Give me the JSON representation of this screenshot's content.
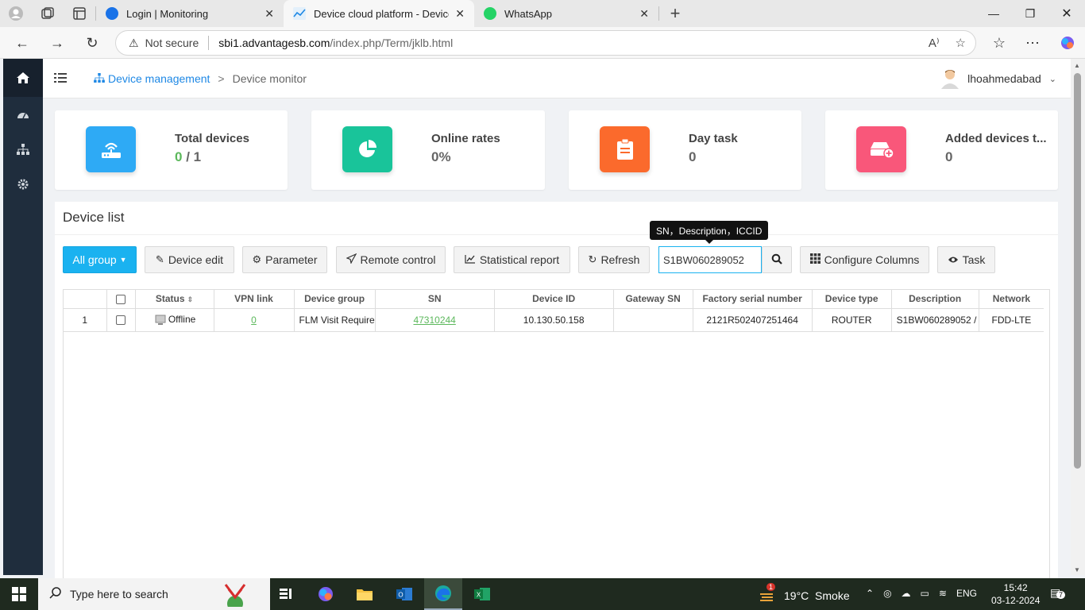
{
  "browser": {
    "tabs": [
      {
        "title": "Login | Monitoring",
        "active": false,
        "favicon_color": "#1a73e8"
      },
      {
        "title": "Device cloud platform - Device m",
        "active": true,
        "favicon_color": "#1e88e5"
      },
      {
        "title": "WhatsApp",
        "active": false,
        "favicon_color": "#25d366"
      }
    ],
    "new_tab_label": "+",
    "address": {
      "security_label": "Not secure",
      "host": "sbi1.advantagesb.com",
      "path": "/index.php/Term/jklb.html"
    }
  },
  "header": {
    "breadcrumb_root": "Device management",
    "breadcrumb_sep": ">",
    "breadcrumb_current": "Device monitor",
    "username": "lhoahmedabad"
  },
  "stats": [
    {
      "label": "Total devices",
      "value_online": "0",
      "value_sep": " / ",
      "value_total": "1",
      "color": "#2eaaf5",
      "icon": "router-icon"
    },
    {
      "label": "Online rates",
      "value": "0%",
      "color": "#19c49a",
      "icon": "pie-chart-icon"
    },
    {
      "label": "Day task",
      "value": "0",
      "color": "#fb6a2c",
      "icon": "clipboard-icon"
    },
    {
      "label": "Added devices t...",
      "value": "0",
      "color": "#f9577a",
      "icon": "add-device-icon"
    }
  ],
  "panel": {
    "title": "Device list",
    "toolbar": {
      "group": "All group",
      "device_edit": "Device edit",
      "parameter": "Parameter",
      "remote_control": "Remote control",
      "statistical_report": "Statistical report",
      "refresh": "Refresh",
      "search_value": "S1BW060289052",
      "search_tooltip": "SN，Description，ICCID",
      "configure_columns": "Configure Columns",
      "task": "Task"
    },
    "table": {
      "columns": [
        "Status",
        "VPN link",
        "Device group",
        "SN",
        "Device ID",
        "Gateway SN",
        "Factory serial number",
        "Device type",
        "Description",
        "Network"
      ],
      "rows": [
        {
          "index": "1",
          "status": "Offline",
          "vpn_link": "0",
          "device_group": "FLM Visit Require",
          "sn": "47310244",
          "device_id": "10.130.50.158",
          "gateway_sn": "",
          "factory_serial": "2121R502407251464",
          "device_type": "ROUTER",
          "description": "S1BW060289052 /",
          "network": "FDD-LTE"
        }
      ]
    }
  },
  "taskbar": {
    "search_placeholder": "Type here to search",
    "weather": "19°C  Smoke",
    "weather_badge": "1",
    "lang": "ENG",
    "time": "15:42",
    "date": "03-12-2024",
    "notifications": "7"
  }
}
